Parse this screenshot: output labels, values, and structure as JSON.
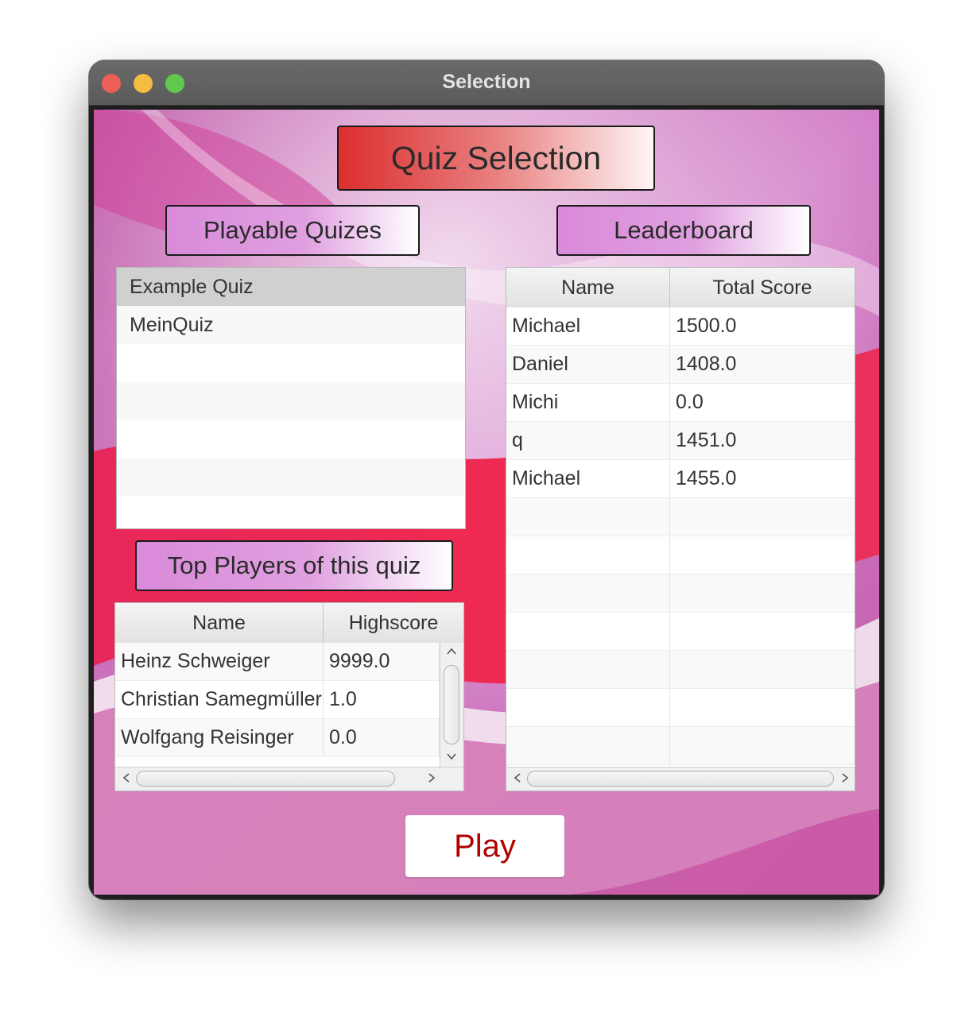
{
  "window": {
    "title": "Selection"
  },
  "headings": {
    "quiz_selection": "Quiz Selection",
    "playable_quizzes": "Playable Quizes",
    "leaderboard": "Leaderboard",
    "top_players": "Top Players of this quiz"
  },
  "quiz_list": {
    "items": [
      "Example Quiz",
      "MeinQuiz"
    ],
    "selected_index": 0
  },
  "top_players_table": {
    "columns": [
      "Name",
      "Highscore"
    ],
    "rows": [
      [
        "Heinz Schweiger",
        "9999.0"
      ],
      [
        "Christian Samegmüller",
        "1.0"
      ],
      [
        "Wolfgang Reisinger",
        "0.0"
      ]
    ]
  },
  "leaderboard_table": {
    "columns": [
      "Name",
      "Total Score"
    ],
    "rows": [
      [
        "Michael",
        "1500.0"
      ],
      [
        "Daniel",
        "1408.0"
      ],
      [
        "Michi",
        "0.0"
      ],
      [
        "q",
        "1451.0"
      ],
      [
        "Michael",
        "1455.0"
      ]
    ]
  },
  "play_button": {
    "label": "Play"
  },
  "colors": {
    "heading_red": "#dc2e2e",
    "heading_purple": "#d98ad9",
    "play_text": "#b00000"
  },
  "icons": {
    "scroll_left": "chevron-left-icon",
    "scroll_right": "chevron-right-icon",
    "scroll_up": "chevron-up-icon",
    "scroll_down": "chevron-down-icon"
  }
}
